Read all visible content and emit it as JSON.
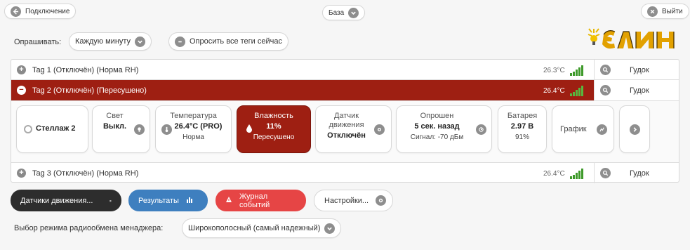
{
  "header": {
    "connect_label": "Подключение",
    "base_label": "База",
    "exit_label": "Выйти"
  },
  "poll": {
    "label": "Опрашивать:",
    "selected": "Каждую минуту",
    "poll_all_label": "Опросить все теги сейчас"
  },
  "logo": {
    "text": "ЭЛИН"
  },
  "tags": [
    {
      "name": "Tag 1 (Отключён) (Норма RH)",
      "temp": "26.3°C",
      "beep": "Гудок",
      "expanded": false
    },
    {
      "name": "Tag 2 (Отключён) (Пересушено)",
      "temp": "26.4°C",
      "beep": "Гудок",
      "expanded": true
    },
    {
      "name": "Tag 3 (Отключён) (Норма RH)",
      "temp": "26.4°C",
      "beep": "Гудок",
      "expanded": false
    }
  ],
  "detail": {
    "location": "Стеллаж 2",
    "light": {
      "title": "Свет",
      "value": "Выкл."
    },
    "temperature": {
      "title": "Температура",
      "value": "26.4°C (PRO)",
      "status": "Норма"
    },
    "humidity": {
      "title": "Влажность",
      "value": "11%",
      "status": "Пересушено"
    },
    "motion": {
      "title_1": "Датчик",
      "title_2": "движения",
      "value": "Отключён"
    },
    "polled": {
      "title": "Опрошен",
      "value": "5 сек. назад",
      "signal": "Сигнал: -70 дБм"
    },
    "battery": {
      "title": "Батарея",
      "value": "2.97 В",
      "percent": "91%"
    },
    "graph_label": "График"
  },
  "bottom": {
    "motion_label": "Датчики движения...",
    "results_label": "Результаты",
    "events_label": "Журнал событий",
    "settings_label": "Настройки..."
  },
  "radio": {
    "label": "Выбор режима радиообмена менаджера:",
    "selected": "Широкополосный (самый надежный)"
  },
  "colors": {
    "accent_red": "#9e1f12",
    "button_dark": "#2d2d2d",
    "button_blue": "#3e7fbf",
    "button_red": "#e64545",
    "signal_green": "#3e9a2a"
  }
}
